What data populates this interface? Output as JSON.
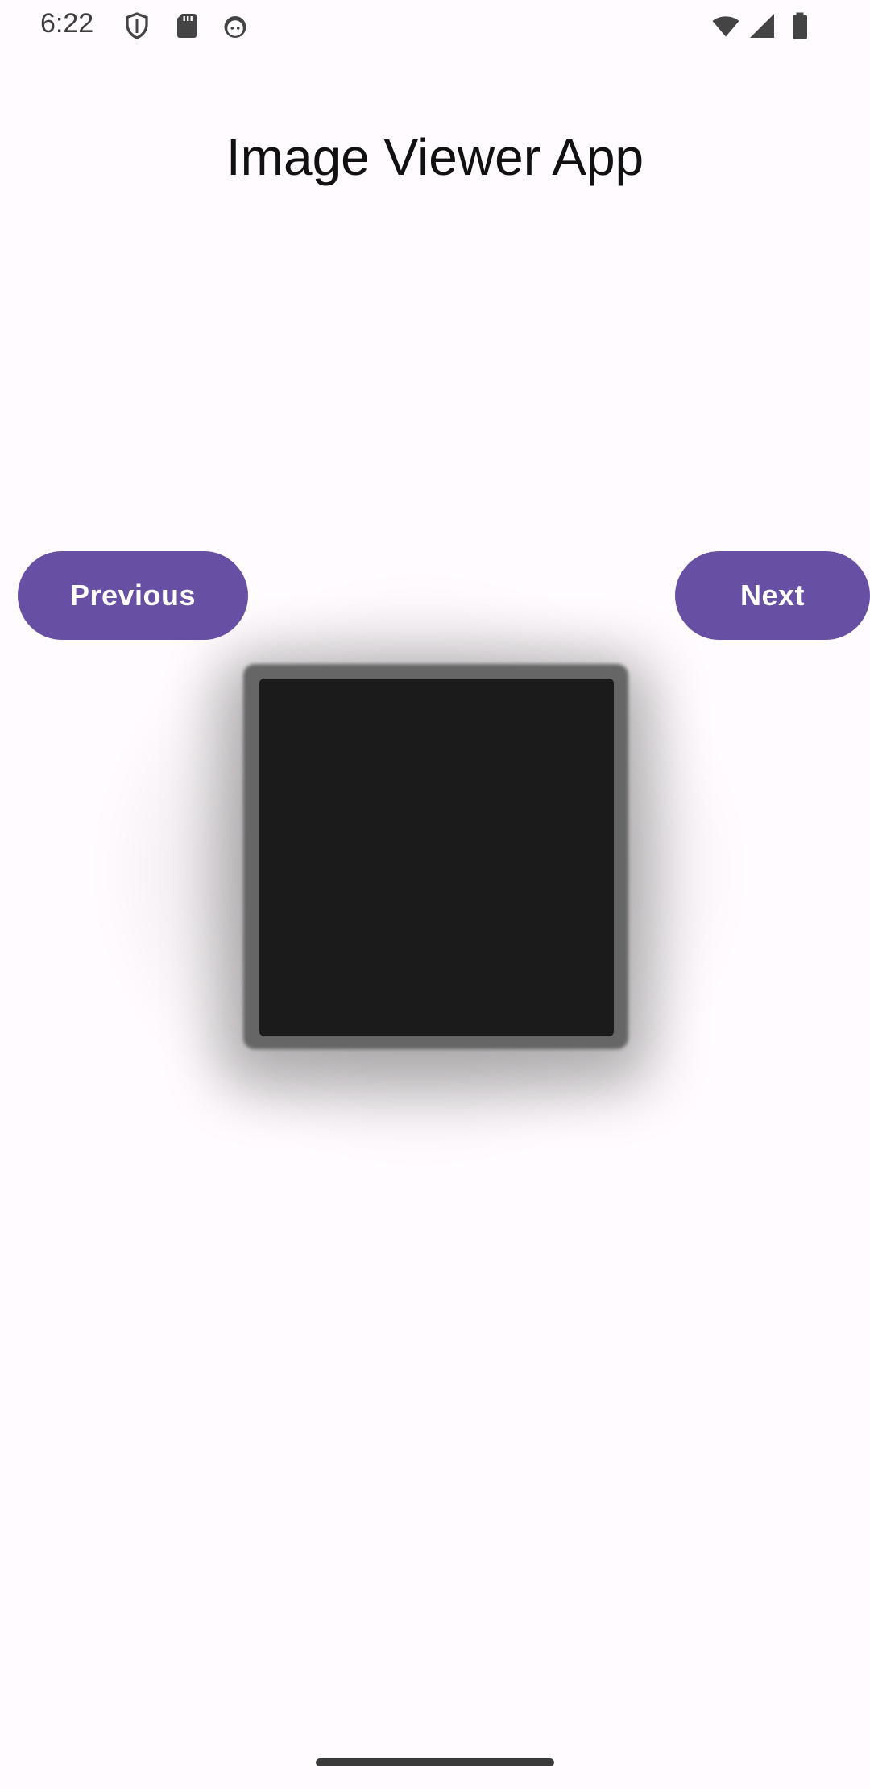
{
  "status_bar": {
    "time": "6:22",
    "left_icons": [
      "shield-icon",
      "sd-card-icon",
      "android-face-icon"
    ],
    "right_icons": [
      "wifi-icon",
      "cellular-signal-icon",
      "battery-icon"
    ]
  },
  "title": "Image Viewer App",
  "buttons": {
    "previous_label": "Previous",
    "next_label": "Next"
  },
  "image": {
    "description_icon": "image-placeholder"
  },
  "colors": {
    "background": "#fffbfe",
    "button": "#6750a4",
    "button_text": "#ffffff",
    "image_fill": "#1c1b1c"
  }
}
